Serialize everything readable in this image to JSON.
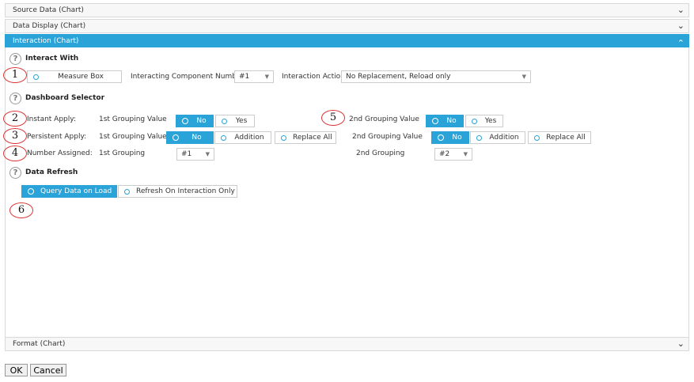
{
  "accordion": {
    "source_data": "Source Data (Chart)",
    "data_display": "Data Display (Chart)",
    "interaction": "Interaction (Chart)",
    "format": "Format (Chart)"
  },
  "icons": {
    "chevron_down": "⌄",
    "chevron_up": "⌃",
    "help": "?"
  },
  "colors": {
    "accent": "#29a3d8",
    "callout_border": "#d33"
  },
  "interact_with": {
    "title": "Interact With",
    "callout": "1",
    "measure_box": "Measure Box",
    "component_number_label": "Interacting Component Number:",
    "component_number_value": "#1",
    "action_label": "Interaction Action:",
    "action_value": "No Replacement, Reload only"
  },
  "dashboard_selector": {
    "title": "Dashboard Selector",
    "instant": {
      "callout": "2",
      "label": "Instant Apply:",
      "g1_label": "1st Grouping Value",
      "g1_no": "No",
      "g1_yes": "Yes",
      "callout2": "5",
      "g2_label": "2nd Grouping Value",
      "g2_no": "No",
      "g2_yes": "Yes"
    },
    "persistent": {
      "callout": "3",
      "label": "Persistent Apply:",
      "g1_label": "1st Grouping Value",
      "g1_no": "No",
      "g1_addition": "Addition",
      "g1_replace": "Replace All",
      "g2_label": "2nd Grouping Value",
      "g2_no": "No",
      "g2_addition": "Addition",
      "g2_replace": "Replace All"
    },
    "number": {
      "callout": "4",
      "label": "Number Assigned:",
      "g1_label": "1st Grouping",
      "g1_value": "#1",
      "g2_label": "2nd Grouping",
      "g2_value": "#2"
    }
  },
  "data_refresh": {
    "title": "Data Refresh",
    "query_on_load": "Query Data on Load",
    "refresh_on_interaction": "Refresh On Interaction Only",
    "callout": "6"
  },
  "footer": {
    "ok": "OK",
    "cancel": "Cancel"
  }
}
